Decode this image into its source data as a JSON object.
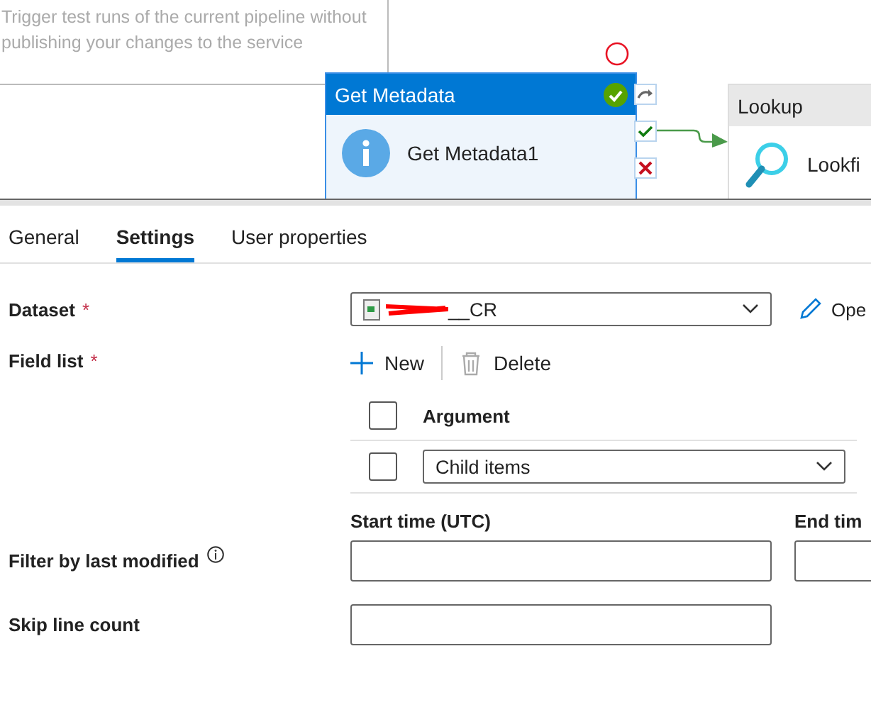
{
  "canvas": {
    "tooltip": "Trigger test runs of the current pipeline without publishing your changes to the service",
    "activities": [
      {
        "kind": "metadata",
        "type": "Get Metadata",
        "name": "Get Metadata1",
        "succeeded": true
      },
      {
        "kind": "lookup",
        "type": "Lookup",
        "name": "Lookfi"
      }
    ]
  },
  "tabs": [
    {
      "label": "General",
      "selected": false
    },
    {
      "label": "Settings",
      "selected": true
    },
    {
      "label": "User properties",
      "selected": false
    }
  ],
  "dataset": {
    "label": "Dataset",
    "required": true,
    "required_mark": "*",
    "value": "__CR",
    "edit_button": "Ope"
  },
  "field_list": {
    "label": "Field list",
    "required": true,
    "required_mark": "*",
    "new_button": "New",
    "delete_button": "Delete",
    "header": "Argument",
    "header_checked": false,
    "rows": [
      {
        "value": "Child items",
        "checked": false
      }
    ]
  },
  "filter": {
    "label": "Filter by last modified",
    "start_label": "Start time (UTC)",
    "end_label": "End tim"
  },
  "skip_line_count": {
    "label": "Skip line count"
  }
}
